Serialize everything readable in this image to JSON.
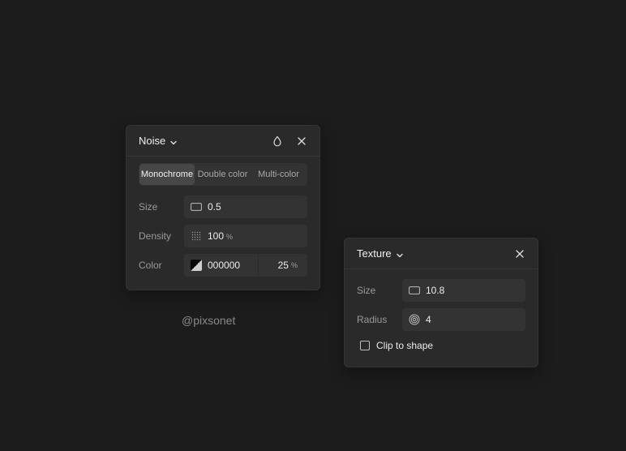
{
  "noise_panel": {
    "title": "Noise",
    "tabs": [
      {
        "label": "Monochrome",
        "active": true
      },
      {
        "label": "Double color",
        "active": false
      },
      {
        "label": "Multi-color",
        "active": false
      }
    ],
    "size": {
      "label": "Size",
      "value": "0.5"
    },
    "density": {
      "label": "Density",
      "value": "100",
      "unit": "%"
    },
    "color": {
      "label": "Color",
      "hex": "000000",
      "opacity": "25",
      "unit": "%"
    }
  },
  "credit": "@pixsonet",
  "texture_panel": {
    "title": "Texture",
    "size": {
      "label": "Size",
      "value": "10.8"
    },
    "radius": {
      "label": "Radius",
      "value": "4"
    },
    "clip": {
      "label": "Clip to shape",
      "checked": false
    }
  },
  "colors": {
    "background": "#1c1c1c",
    "panel": "#2a2a2a",
    "field": "#333333"
  }
}
